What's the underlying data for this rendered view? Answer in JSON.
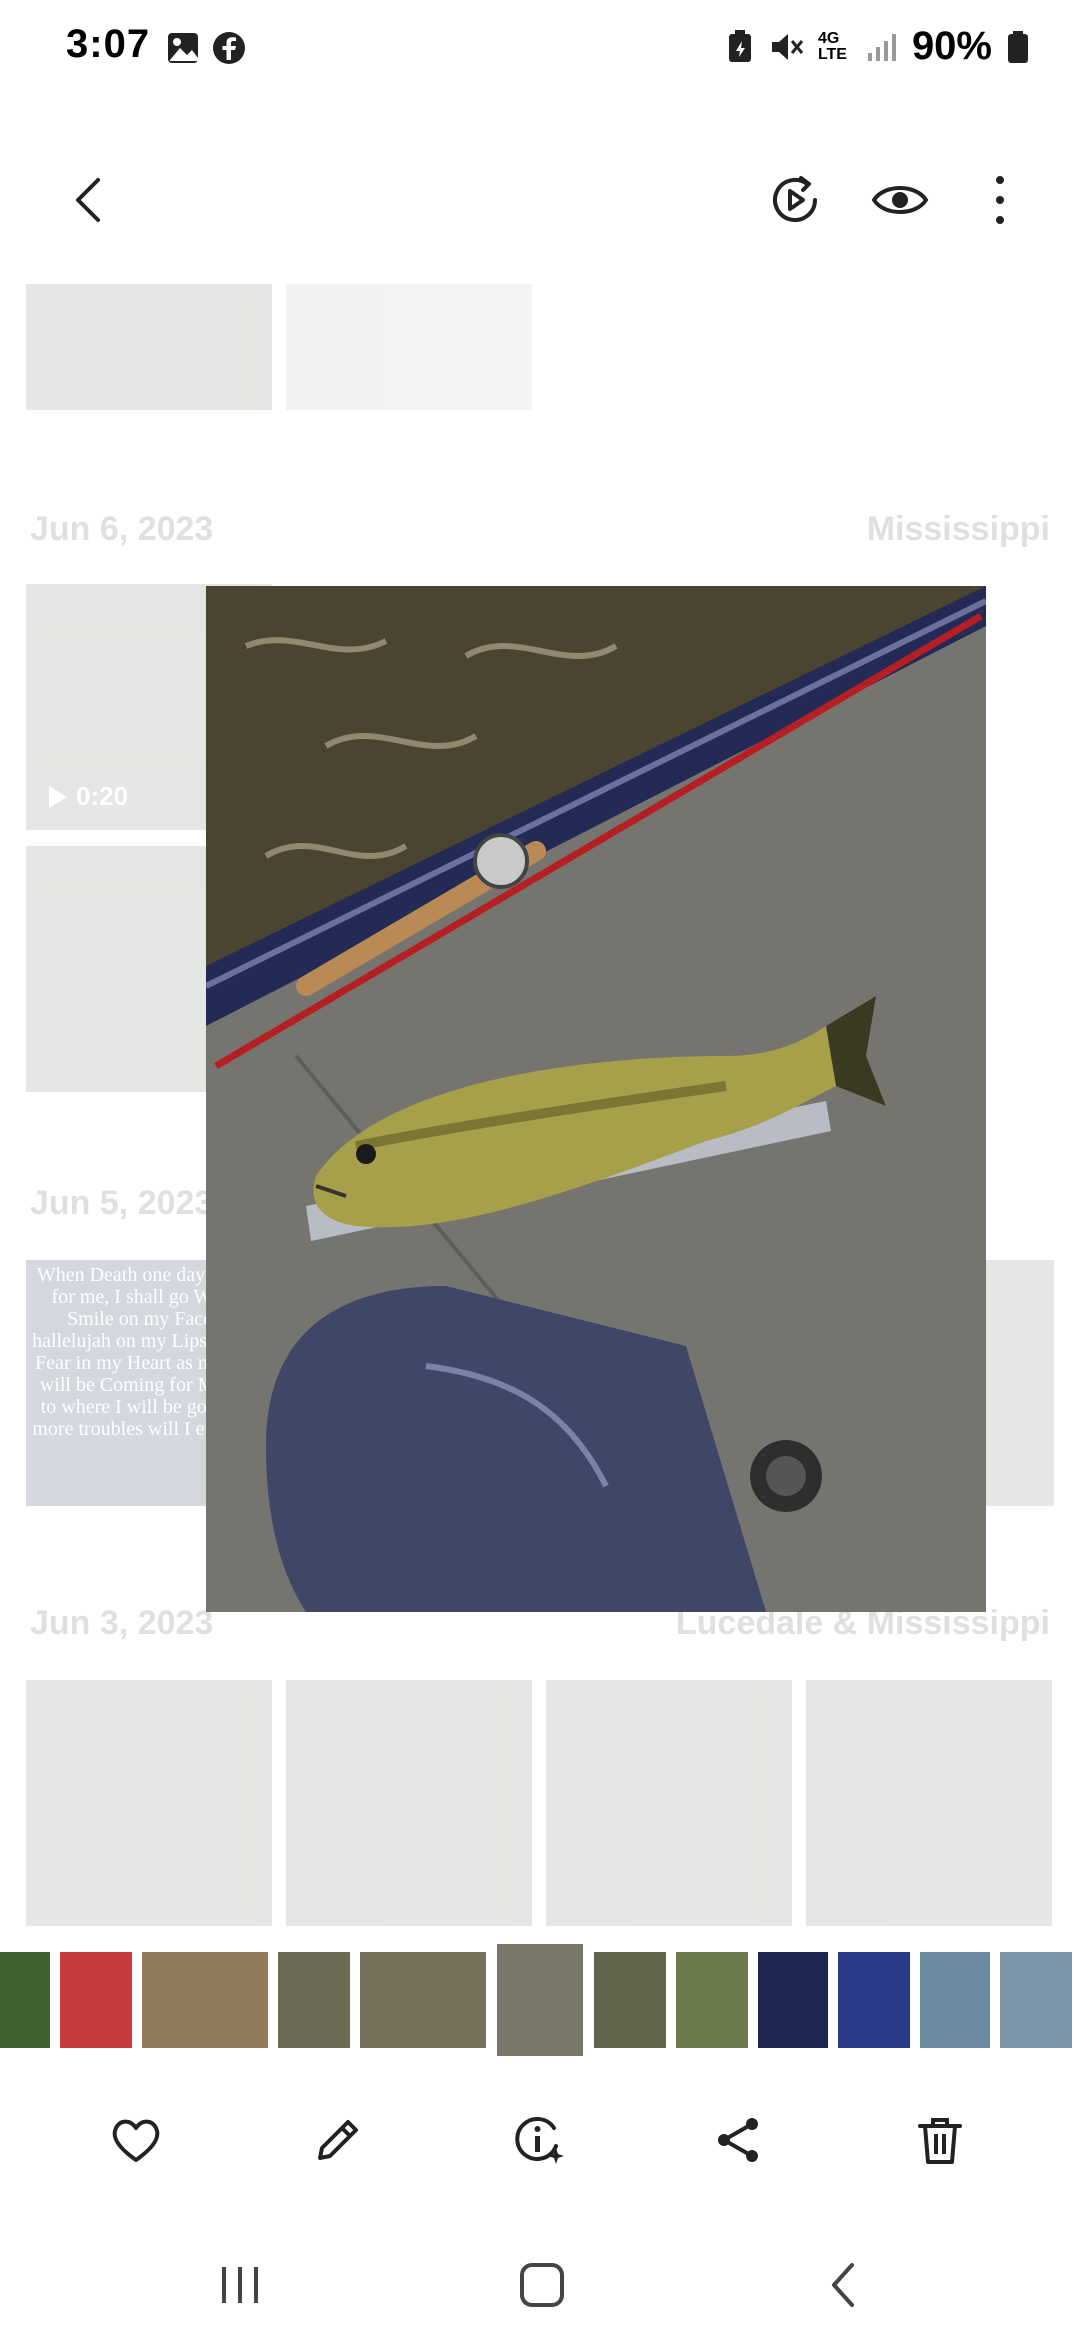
{
  "status": {
    "time": "3:07",
    "battery": "90%",
    "network": "4G LTE"
  },
  "toolbar": {
    "back_icon": "chevron-left-icon",
    "icons": [
      "motion-play-icon",
      "eye-icon",
      "more-vert-icon"
    ]
  },
  "gallery": {
    "sections": [
      {
        "date": "Jun 6, 2023",
        "location": "Mississippi"
      },
      {
        "date": "Jun 5, 2023",
        "location": ""
      },
      {
        "date": "Jun 3, 2023",
        "location": "Lucedale & Mississippi"
      }
    ],
    "video_duration": "0:20",
    "quote_text": "When Death one day comes for me, I shall go With a Smile on my Face, a hallelujah on my Lips and no Fear in my Heart as my God will be Coming for Me and to where I will be going no more troubles will I ever see."
  },
  "actions": [
    "heart-icon",
    "edit-icon",
    "info-icon",
    "share-icon",
    "trash-icon"
  ],
  "navigation": [
    "recents-icon",
    "home-icon",
    "back-icon"
  ]
}
